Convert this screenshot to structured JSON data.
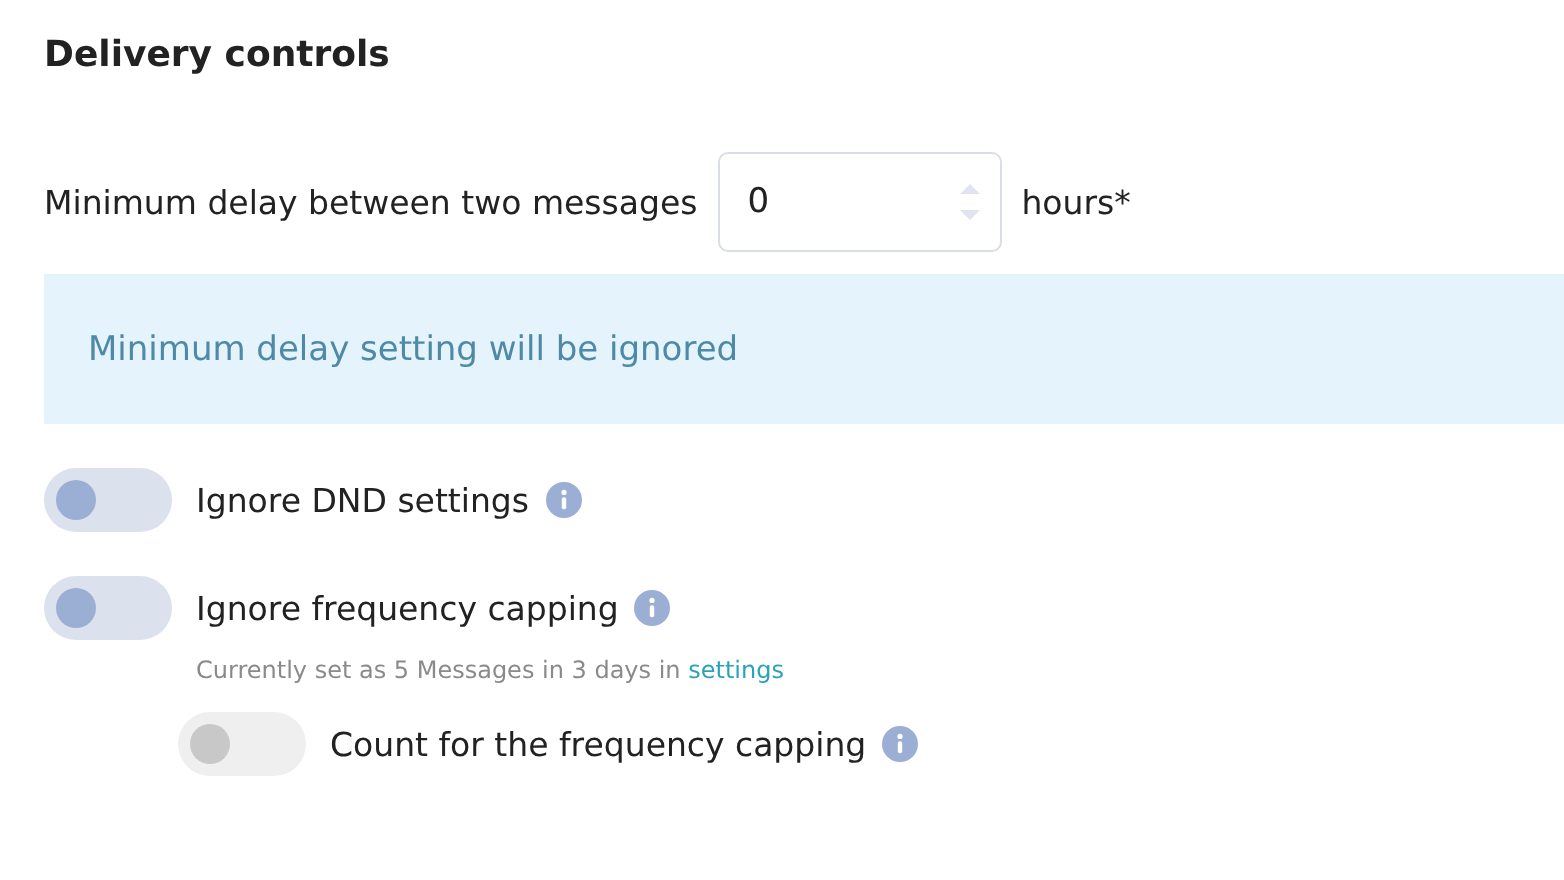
{
  "section_title": "Delivery controls",
  "delay": {
    "label": "Minimum delay between two messages",
    "value": "0",
    "unit": "hours*"
  },
  "notice": "Minimum delay setting will be ignored",
  "toggles": [
    {
      "label": "Ignore DND settings",
      "on": false,
      "disabled": false,
      "nested": false
    },
    {
      "label": "Ignore frequency capping",
      "on": false,
      "disabled": false,
      "nested": false,
      "hint": {
        "text": "Currently set as 5 Messages in 3 days in ",
        "link": "settings"
      }
    },
    {
      "label": "Count for the frequency capping",
      "on": false,
      "disabled": true,
      "nested": true
    }
  ]
}
